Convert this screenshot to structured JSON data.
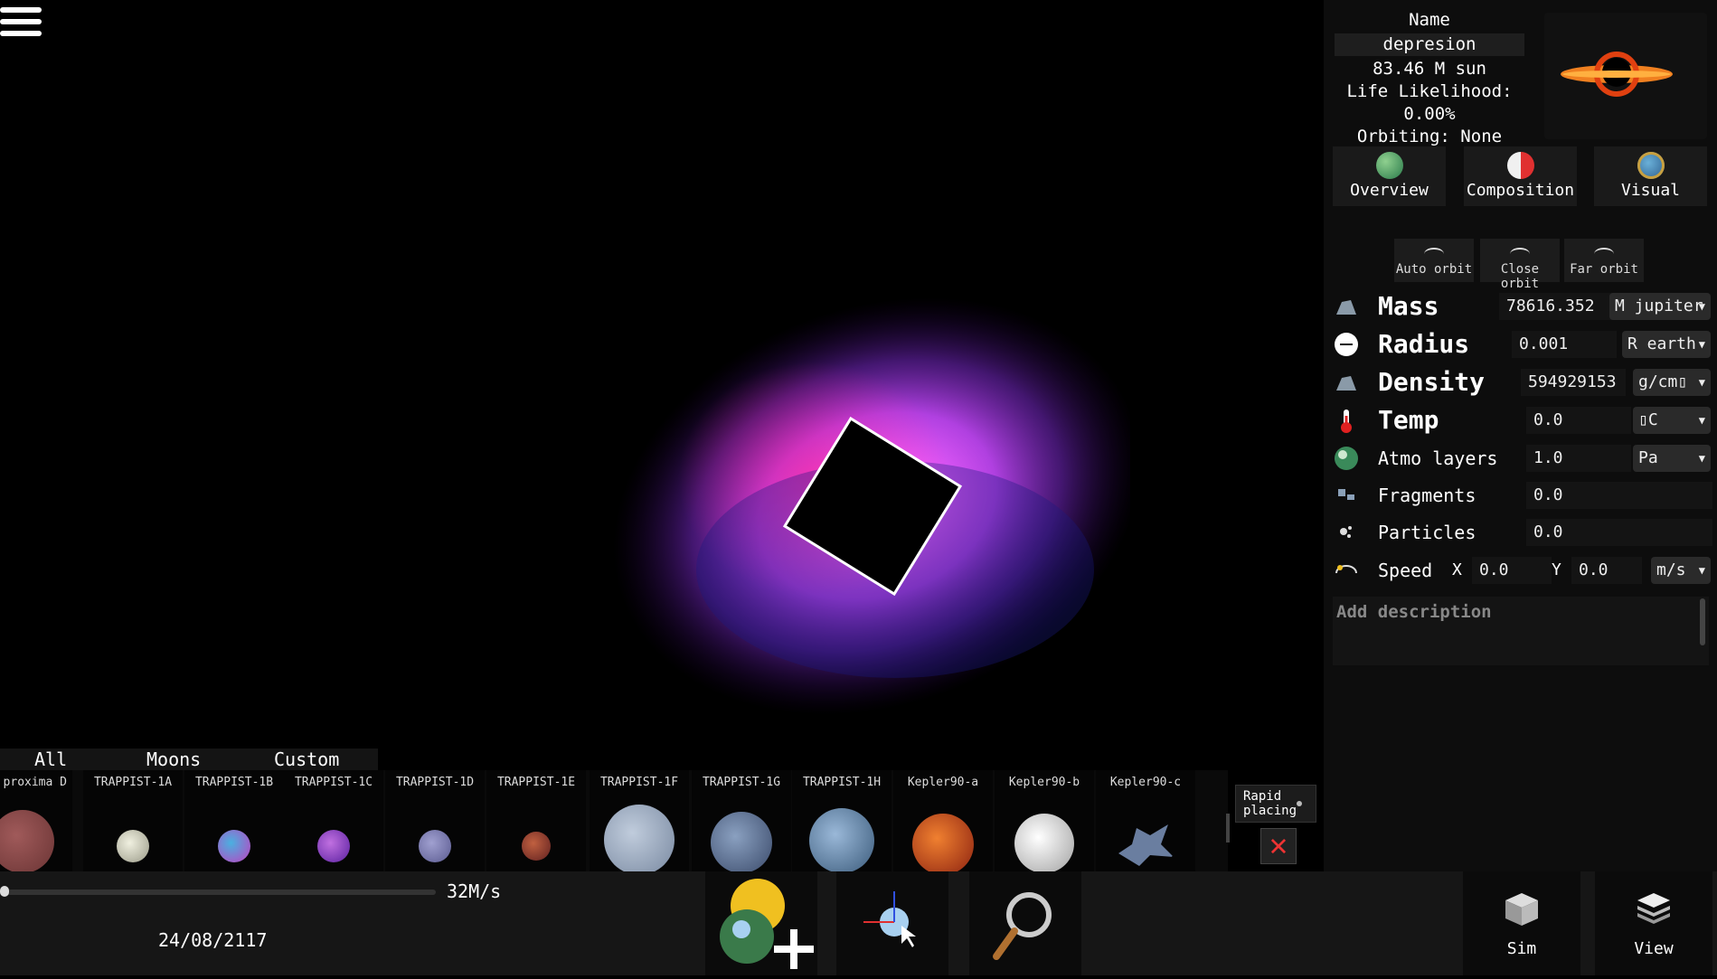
{
  "info": {
    "name_label": "Name",
    "name_value": "depresion",
    "mass_summary": "83.46 M sun",
    "life_likelihood": "Life Likelihood:  0.00%",
    "orbiting": "Orbiting: None"
  },
  "tabs": [
    {
      "label": "Overview",
      "icon": "planet-icon"
    },
    {
      "label": "Composition",
      "icon": "composition-icon"
    },
    {
      "label": "Visual",
      "icon": "visual-icon"
    }
  ],
  "orbit_buttons": [
    {
      "label": "Auto orbit"
    },
    {
      "label": "Close orbit"
    },
    {
      "label": "Far orbit"
    }
  ],
  "properties": {
    "mass": {
      "label": "Mass",
      "value": "78616.352",
      "unit": "M jupiter"
    },
    "radius": {
      "label": "Radius",
      "value": "0.001",
      "unit": "R earth"
    },
    "density": {
      "label": "Density",
      "value": "594929153",
      "unit": "g/cm▯"
    },
    "temp": {
      "label": "Temp",
      "value": "0.0",
      "unit": "▯C"
    },
    "atmo": {
      "label": "Atmo layers",
      "value": "1.0",
      "unit": "Pa"
    },
    "fragments": {
      "label": "Fragments",
      "value": "0.0"
    },
    "particles": {
      "label": "Particles",
      "value": "0.0"
    },
    "speed": {
      "label": "Speed",
      "x_label": "X",
      "x_value": "0.0",
      "y_label": "Y",
      "y_value": "0.0",
      "unit": "m/s"
    }
  },
  "description_placeholder": "Add description",
  "catalog_tabs": [
    "All",
    "Moons",
    "Custom"
  ],
  "catalog": [
    {
      "name": "proxima D",
      "color": "#8a4a4a"
    },
    {
      "name": "TRAPPIST-1A",
      "color": "#d8d6c4"
    },
    {
      "name": "TRAPPIST-1B",
      "color": "#b05ad8"
    },
    {
      "name": "TRAPPIST-1C",
      "color": "#8a4ad8"
    },
    {
      "name": "TRAPPIST-1D",
      "color": "#8a8ac4"
    },
    {
      "name": "TRAPPIST-1E",
      "color": "#a04a3a"
    },
    {
      "name": "TRAPPIST-1F",
      "color": "#a8b4c8"
    },
    {
      "name": "TRAPPIST-1G",
      "color": "#5a6a8a"
    },
    {
      "name": "TRAPPIST-1H",
      "color": "#6a8aa8"
    },
    {
      "name": "Kepler90-a",
      "color": "#c84a1a"
    },
    {
      "name": "Kepler90-b",
      "color": "#e0e0e0"
    },
    {
      "name": "Kepler90-c",
      "color": "#5a6a8a"
    }
  ],
  "rapid_placing": "Rapid placing",
  "sim_speed": "32M/s",
  "date": "24/08/2117",
  "right_buttons": [
    {
      "label": "Sim"
    },
    {
      "label": "View"
    }
  ]
}
